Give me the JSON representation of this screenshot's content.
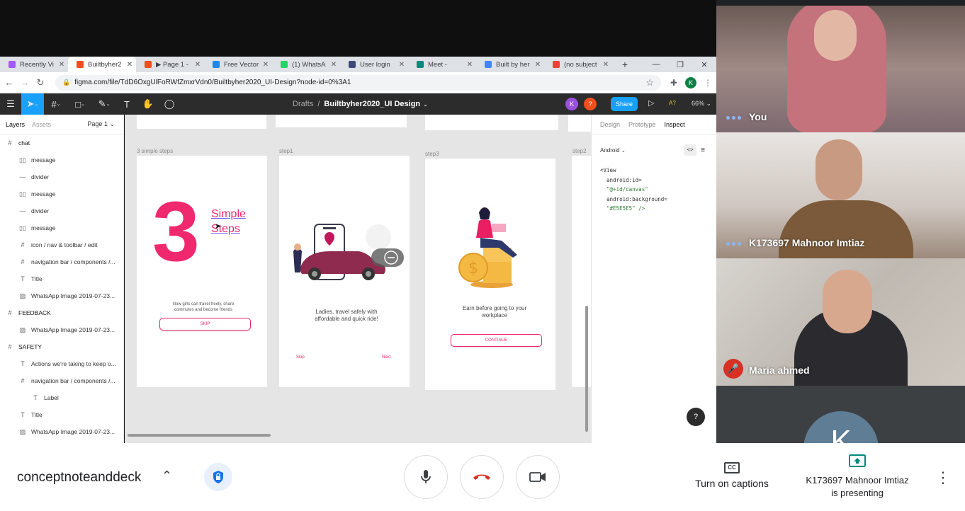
{
  "browser": {
    "tabs": [
      {
        "title": "Recently Vi",
        "color": "#a259ff"
      },
      {
        "title": "Builtbyher2",
        "color": "#f24e1e",
        "active": true
      },
      {
        "title": "▶ Page 1 -",
        "color": "#f24e1e"
      },
      {
        "title": "Free Vector",
        "color": "#1e88e5"
      },
      {
        "title": "(1) WhatsA",
        "color": "#25d366"
      },
      {
        "title": "User login",
        "color": "#3c4a7a"
      },
      {
        "title": "Meet -",
        "color": "#00897b"
      },
      {
        "title": "Built by her",
        "color": "#4285f4"
      },
      {
        "title": "(no subject",
        "color": "#ea4335"
      }
    ],
    "url": "figma.com/file/TdD6OxgUlFoRWfZmxrVdn0/Builtbyher2020_UI-Design?node-id=0%3A1",
    "profile_initial": "K"
  },
  "figma": {
    "breadcrumb_parent": "Drafts",
    "breadcrumb_sep": "/",
    "file_name": "Builtbyher2020_UI Design",
    "share_label": "Share",
    "zoom": "66%",
    "a11y": "A?",
    "avatar1": "K",
    "avatar2": "?",
    "left_tabs": {
      "layers": "Layers",
      "assets": "Assets",
      "page": "Page 1"
    },
    "layers": [
      {
        "icon": "#",
        "label": "chat",
        "indent": 0
      },
      {
        "icon": "▯▯",
        "label": "message",
        "indent": 1
      },
      {
        "icon": "—",
        "label": "divider",
        "indent": 1
      },
      {
        "icon": "▯▯",
        "label": "message",
        "indent": 1
      },
      {
        "icon": "—",
        "label": "divider",
        "indent": 1
      },
      {
        "icon": "▯▯",
        "label": "message",
        "indent": 1
      },
      {
        "icon": "#",
        "label": "icon / nav & toolbar / edit",
        "indent": 1
      },
      {
        "icon": "#",
        "label": "navigation bar / components /...",
        "indent": 1
      },
      {
        "icon": "T",
        "label": "Title",
        "indent": 1
      },
      {
        "icon": "▨",
        "label": "WhatsApp Image 2019-07-23...",
        "indent": 1
      },
      {
        "icon": "#",
        "label": "FEEDBACK",
        "indent": 0
      },
      {
        "icon": "▨",
        "label": "WhatsApp Image 2019-07-23...",
        "indent": 1
      },
      {
        "icon": "#",
        "label": "SAFETY",
        "indent": 0
      },
      {
        "icon": "T",
        "label": "Actions we're taking to keep o...",
        "indent": 1
      },
      {
        "icon": "#",
        "label": "navigation bar / components /...",
        "indent": 1
      },
      {
        "icon": "T",
        "label": "Label",
        "indent": 2
      },
      {
        "icon": "T",
        "label": "Title",
        "indent": 1
      },
      {
        "icon": "▨",
        "label": "WhatsApp Image 2019-07-23...",
        "indent": 1
      }
    ],
    "frames": {
      "f1": {
        "label": "3 simple steps",
        "big_number": "3",
        "heading1": "Simple",
        "heading2": "Steps",
        "body": "Now girls can travel freely, share commutes and become friends",
        "button": "SKIP"
      },
      "f2": {
        "label": "step1",
        "body": "Ladies, travel safely with affordable and quick ride!",
        "skip": "Skip",
        "next": "Next"
      },
      "f3": {
        "label": "step3",
        "body": "Earn before going to your workplace",
        "button": "CONTINUE"
      },
      "f4": {
        "label": "step2"
      }
    },
    "right_tabs": {
      "design": "Design",
      "prototype": "Prototype",
      "inspect": "Inspect"
    },
    "platform": "Android",
    "code_lines": [
      "<View",
      "  android:id=",
      "  \"@+id/canvas\"",
      "  android:background=",
      "  \"#E5E5E5\" />"
    ],
    "help": "?"
  },
  "meet": {
    "participants": [
      {
        "name": "You",
        "indicator": "dots"
      },
      {
        "name": "K173697 Mahnoor Imtiaz",
        "indicator": "dots"
      },
      {
        "name": "Maria ahmed",
        "indicator": "muted"
      },
      {
        "name": "",
        "avatar": "K"
      }
    ],
    "meeting_name": "conceptnoteanddeck",
    "captions_label": "Turn on captions",
    "presenting_line1": "K173697 Mahnoor Imtiaz",
    "presenting_line2": "is presenting"
  },
  "colors": {
    "figma_blue": "#18a0fb",
    "pink": "#f0286e",
    "meet_red": "#d93025"
  }
}
